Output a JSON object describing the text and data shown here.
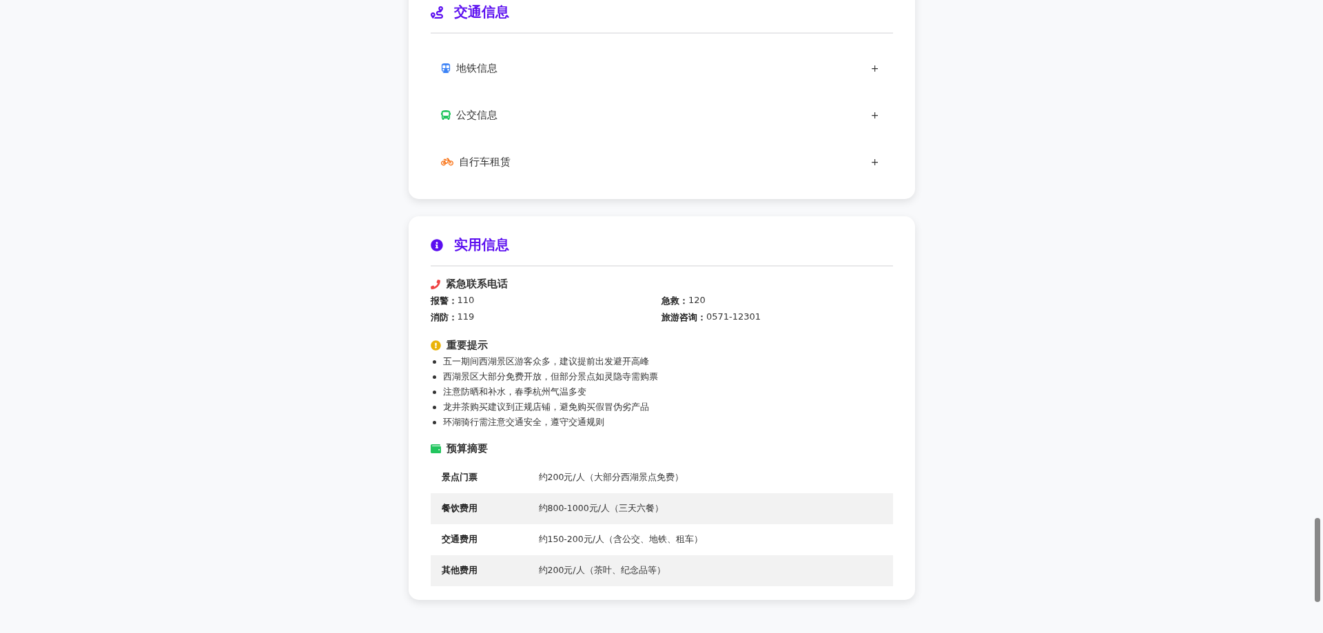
{
  "transport": {
    "title": "交通信息",
    "items": [
      {
        "kind": "subway",
        "label": "地铁信息",
        "toggle": "+",
        "color": "#3b82f6"
      },
      {
        "kind": "bus",
        "label": "公交信息",
        "toggle": "+",
        "color": "#22c55e"
      },
      {
        "kind": "bike",
        "label": "自行车租赁",
        "toggle": "+",
        "color": "#f97316"
      }
    ]
  },
  "practical": {
    "title": "实用信息",
    "emergency": {
      "title": "紧急联系电话",
      "contacts": [
        {
          "label": "报警：",
          "value": "110"
        },
        {
          "label": "急救：",
          "value": "120"
        },
        {
          "label": "消防：",
          "value": "119"
        },
        {
          "label": "旅游咨询：",
          "value": "0571-12301"
        }
      ]
    },
    "tips": {
      "title": "重要提示",
      "items": [
        "五一期间西湖景区游客众多，建议提前出发避开高峰",
        "西湖景区大部分免费开放，但部分景点如灵隐寺需购票",
        "注意防晒和补水，春季杭州气温多变",
        "龙井茶购买建议到正规店铺，避免购买假冒伪劣产品",
        "环湖骑行需注意交通安全，遵守交通规则"
      ]
    },
    "budget": {
      "title": "预算摘要",
      "rows": [
        {
          "item": "景点门票",
          "cost": "约200元/人（大部分西湖景点免费）"
        },
        {
          "item": "餐饮费用",
          "cost": "约800-1000元/人（三天六餐）"
        },
        {
          "item": "交通费用",
          "cost": "约150-200元/人（含公交、地铁、租车）"
        },
        {
          "item": "其他费用",
          "cost": "约200元/人（茶叶、纪念品等）"
        }
      ]
    }
  }
}
